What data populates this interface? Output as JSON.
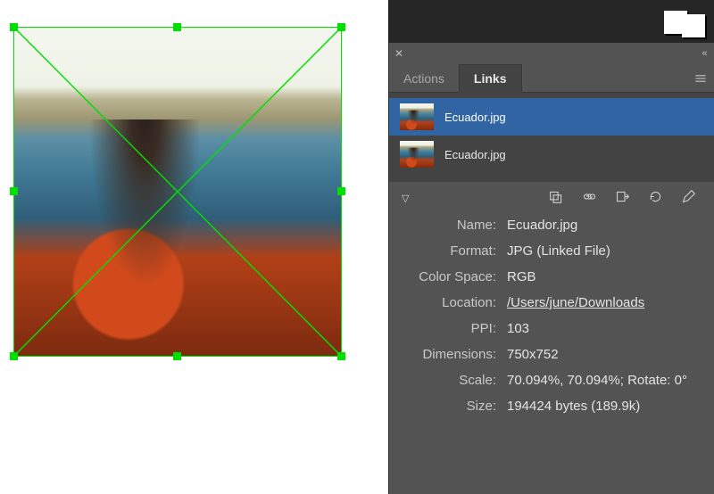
{
  "panel": {
    "tabs": [
      {
        "label": "Actions",
        "active": false
      },
      {
        "label": "Links",
        "active": true
      }
    ],
    "links": [
      {
        "name": "Ecuador.jpg",
        "selected": true
      },
      {
        "name": "Ecuador.jpg",
        "selected": false
      }
    ],
    "detail_labels": {
      "name": "Name:",
      "format": "Format:",
      "color_space": "Color Space:",
      "location": "Location:",
      "ppi": "PPI:",
      "dimensions": "Dimensions:",
      "scale": "Scale:",
      "size": "Size:"
    },
    "details": {
      "name": "Ecuador.jpg",
      "format": "JPG (Linked File)",
      "color_space": "RGB",
      "location": "/Users/june/Downloads",
      "ppi": "103",
      "dimensions": "750x752",
      "scale": "70.094%, 70.094%; Rotate: 0°",
      "size": "194424 bytes (189.9k)"
    }
  }
}
